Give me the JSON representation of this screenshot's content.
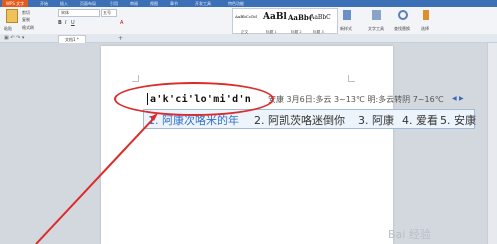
{
  "app_tab": "WPS 文字",
  "menu": [
    "开始",
    "插入",
    "页面布局",
    "引用",
    "审阅",
    "视图",
    "章节",
    "开发工具",
    "特色功能"
  ],
  "ribbon": {
    "paste": "粘贴",
    "cut": "剪切",
    "copy": "复制",
    "format_brush": "格式刷",
    "font": "宋体",
    "size": "五号",
    "styles": [
      {
        "preview": "AaBbCcDd",
        "name": "正文"
      },
      {
        "preview": "AaBl",
        "name": "标题 1"
      },
      {
        "preview": "AaBb(",
        "name": "标题 2"
      },
      {
        "preview": "AaBbC",
        "name": "标题 3"
      }
    ],
    "new_style": "新样式",
    "text_tools": "文字工具",
    "find_replace": "查找替换",
    "select": "选择"
  },
  "doc_tab": "文档1 *",
  "pinyin_input": "a'k'ci'lo'mi'd'n",
  "weather": "安康 3月6日:多云 3~13℃ 明:多云转阴 7~16℃",
  "candidates": [
    {
      "text": "1. 阿康次咯米的年",
      "highlight": true
    },
    {
      "text": "2. 阿凯茨咯迷倒你",
      "highlight": false
    },
    {
      "text": "3. 阿康",
      "highlight": false
    },
    {
      "text": "4. 爱看",
      "highlight": false
    },
    {
      "text": "5. 安康",
      "highlight": false
    }
  ],
  "highlight_color": "#2f6fcf",
  "annotation_color": "#dc2b2b",
  "watermark": "Bai 经验"
}
